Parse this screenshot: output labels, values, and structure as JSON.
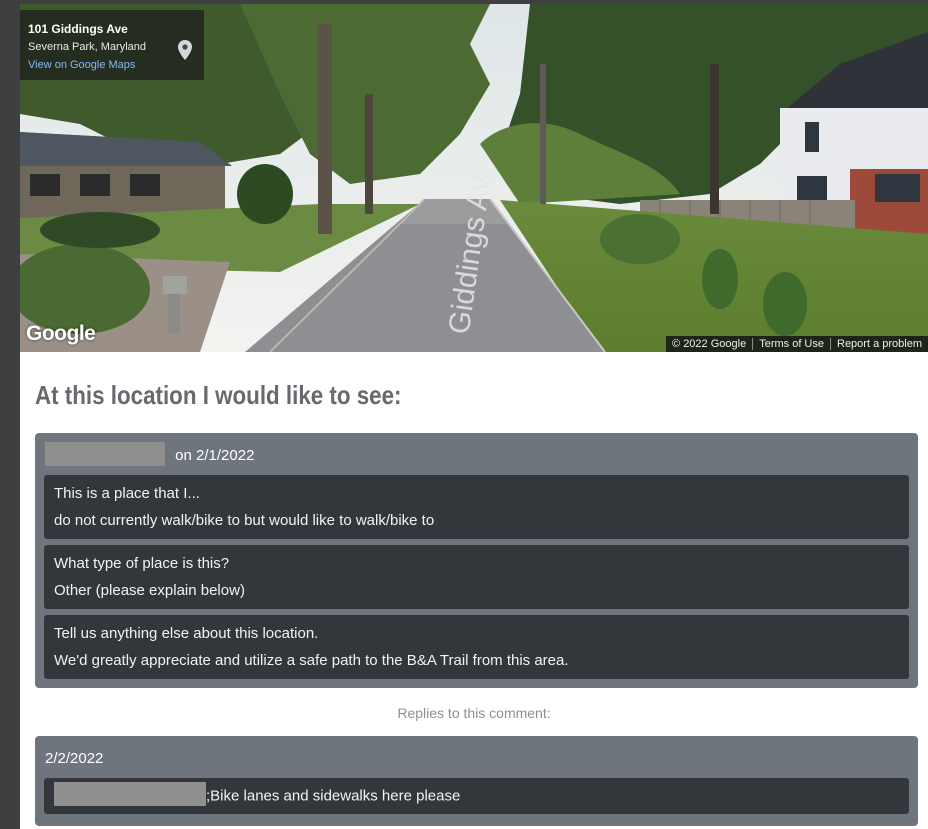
{
  "street_view": {
    "address": "101 Giddings Ave",
    "locality": "Severna Park, Maryland",
    "maps_link": "View on Google Maps",
    "logo": "Google",
    "road_label": "Giddings Av",
    "footer": [
      "© 2022 Google",
      "Terms of Use",
      "Report a problem"
    ]
  },
  "heading": "At this location I would like to see:",
  "comment": {
    "date_text": "on 2/1/2022",
    "answers": [
      {
        "question": "This is a place that I...",
        "answer": "do not currently walk/bike to but would like to walk/bike to"
      },
      {
        "question": "What type of place is this?",
        "answer": "Other (please explain below)"
      },
      {
        "question": "Tell us anything else about this location.",
        "answer": "We'd greatly appreciate and utilize a safe path to the B&A Trail from this area."
      }
    ]
  },
  "replies_label": "Replies to this comment:",
  "reply": {
    "date": "2/2/2022",
    "text": ";Bike lanes and sidewalks here please"
  }
}
